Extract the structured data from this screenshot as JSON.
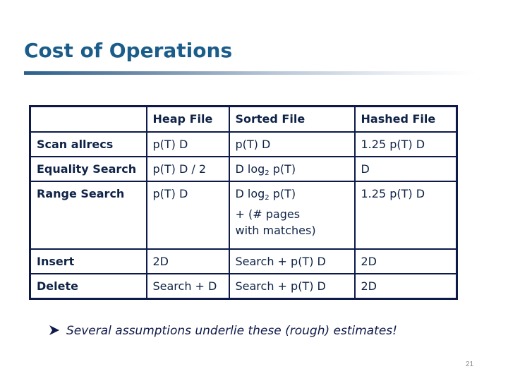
{
  "slide": {
    "title": "Cost of Operations",
    "page_number": "21",
    "note": "Several assumptions underlie these (rough) estimates!",
    "note_bullet_icon": "arrowhead-bullet-icon"
  },
  "table": {
    "headers": [
      "",
      "Heap File",
      "Sorted File",
      "Hashed File"
    ],
    "rows": [
      {
        "operation": "Scan allrecs",
        "heap": "p(T) D",
        "sorted": "p(T) D",
        "hashed": "1.25 p(T) D"
      },
      {
        "operation": "Equality Search",
        "heap": "p(T) D / 2",
        "sorted_prefix": "D log",
        "sorted_sub": "2",
        "sorted_suffix": " p(T)",
        "hashed": "D"
      },
      {
        "operation": "Range Search",
        "heap": "p(T) D",
        "sorted_prefix": "D log",
        "sorted_sub": "2",
        "sorted_suffix": " p(T)",
        "sorted_line2": "+ (# pages",
        "sorted_line3": "with matches)",
        "hashed": "1.25 p(T) D"
      },
      {
        "operation": "Insert",
        "heap": "2D",
        "sorted": "Search + p(T) D",
        "hashed": "2D"
      },
      {
        "operation": "Delete",
        "heap": "Search + D",
        "sorted": "Search + p(T) D",
        "hashed": "2D"
      }
    ]
  },
  "colors": {
    "title": "#1b5d8a",
    "table_border": "#0d1a4a",
    "text": "#0f2347"
  }
}
